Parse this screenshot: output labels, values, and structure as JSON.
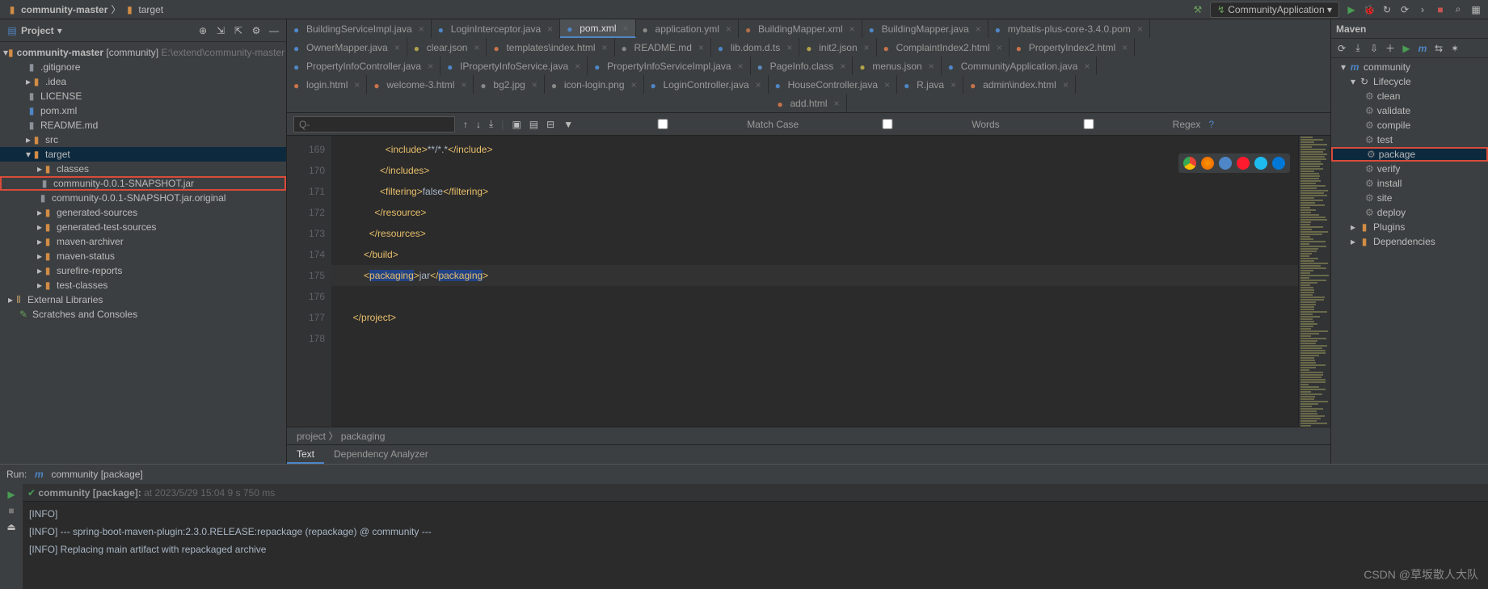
{
  "breadcrumbs": [
    "community-master",
    "target"
  ],
  "runConfig": "CommunityApplication",
  "project": {
    "title": "Project",
    "root": {
      "name": "community-master",
      "module": "[community]",
      "path": "E:\\extend\\community-master"
    },
    "items": [
      {
        "name": ".gitignore",
        "indent": 2,
        "icon": "file"
      },
      {
        "name": ".idea",
        "indent": 2,
        "icon": "folder",
        "arrow": true
      },
      {
        "name": "LICENSE",
        "indent": 2,
        "icon": "file"
      },
      {
        "name": "pom.xml",
        "indent": 2,
        "icon": "maven"
      },
      {
        "name": "README.md",
        "indent": 2,
        "icon": "file"
      },
      {
        "name": "src",
        "indent": 2,
        "icon": "folder",
        "arrow": true
      },
      {
        "name": "target",
        "indent": 2,
        "icon": "folder-orange",
        "arrow": true,
        "sel": true,
        "open": true
      },
      {
        "name": "classes",
        "indent": 3,
        "icon": "folder-orange",
        "arrow": true
      },
      {
        "name": "community-0.0.1-SNAPSHOT.jar",
        "indent": 3,
        "icon": "jar",
        "hl": true
      },
      {
        "name": "community-0.0.1-SNAPSHOT.jar.original",
        "indent": 3,
        "icon": "jar"
      },
      {
        "name": "generated-sources",
        "indent": 3,
        "icon": "folder-orange",
        "arrow": true
      },
      {
        "name": "generated-test-sources",
        "indent": 3,
        "icon": "folder-orange",
        "arrow": true
      },
      {
        "name": "maven-archiver",
        "indent": 3,
        "icon": "folder-orange",
        "arrow": true
      },
      {
        "name": "maven-status",
        "indent": 3,
        "icon": "folder-orange",
        "arrow": true
      },
      {
        "name": "surefire-reports",
        "indent": 3,
        "icon": "folder-orange",
        "arrow": true
      },
      {
        "name": "test-classes",
        "indent": 3,
        "icon": "folder-orange",
        "arrow": true
      }
    ],
    "extras": [
      "External Libraries",
      "Scratches and Consoles"
    ]
  },
  "tabRows": [
    [
      {
        "label": "BuildingServiceImpl.java",
        "icon": "java"
      },
      {
        "label": "LoginInterceptor.java",
        "icon": "java"
      },
      {
        "label": "pom.xml",
        "icon": "maven",
        "active": true
      },
      {
        "label": "application.yml",
        "icon": "yml"
      },
      {
        "label": "BuildingMapper.xml",
        "icon": "xml"
      },
      {
        "label": "BuildingMapper.java",
        "icon": "java"
      },
      {
        "label": "mybatis-plus-core-3.4.0.pom",
        "icon": "maven"
      }
    ],
    [
      {
        "label": "OwnerMapper.java",
        "icon": "java"
      },
      {
        "label": "clear.json",
        "icon": "json"
      },
      {
        "label": "templates\\index.html",
        "icon": "html"
      },
      {
        "label": "README.md",
        "icon": "md"
      },
      {
        "label": "lib.dom.d.ts",
        "icon": "ts"
      },
      {
        "label": "init2.json",
        "icon": "json"
      },
      {
        "label": "ComplaintIndex2.html",
        "icon": "html"
      },
      {
        "label": "PropertyIndex2.html",
        "icon": "html"
      }
    ],
    [
      {
        "label": "PropertyInfoController.java",
        "icon": "java"
      },
      {
        "label": "IPropertyInfoService.java",
        "icon": "java"
      },
      {
        "label": "PropertyInfoServiceImpl.java",
        "icon": "java"
      },
      {
        "label": "PageInfo.class",
        "icon": "class"
      },
      {
        "label": "menus.json",
        "icon": "json"
      },
      {
        "label": "CommunityApplication.java",
        "icon": "java"
      }
    ],
    [
      {
        "label": "login.html",
        "icon": "html"
      },
      {
        "label": "welcome-3.html",
        "icon": "html"
      },
      {
        "label": "bg2.jpg",
        "icon": "img"
      },
      {
        "label": "icon-login.png",
        "icon": "img"
      },
      {
        "label": "LoginController.java",
        "icon": "java"
      },
      {
        "label": "HouseController.java",
        "icon": "java"
      },
      {
        "label": "R.java",
        "icon": "java"
      },
      {
        "label": "admin\\index.html",
        "icon": "html"
      }
    ],
    [
      {
        "label": "add.html",
        "icon": "html",
        "center": true
      }
    ]
  ],
  "search": {
    "placeholder": "Q-",
    "matchCase": "Match Case",
    "words": "Words",
    "regex": "Regex"
  },
  "code": {
    "lines": [
      {
        "n": 169,
        "pad": 20,
        "html": "<span class='tag'>&lt;include&gt;</span><span class='txt'>**/*.*</span><span class='tag'>&lt;/include&gt;</span>"
      },
      {
        "n": 170,
        "pad": 18,
        "html": "<span class='tag'>&lt;/includes&gt;</span>"
      },
      {
        "n": 171,
        "pad": 18,
        "html": "<span class='tag'>&lt;filtering&gt;</span><span class='txt'>false</span><span class='tag'>&lt;/filtering&gt;</span>"
      },
      {
        "n": 172,
        "pad": 16,
        "html": "<span class='tag'>&lt;/resource&gt;</span>"
      },
      {
        "n": 173,
        "pad": 14,
        "html": "<span class='tag'>&lt;/resources&gt;</span>"
      },
      {
        "n": 174,
        "pad": 12,
        "html": "<span class='tag'>&lt;/build&gt;</span>"
      },
      {
        "n": 175,
        "pad": 12,
        "html": "<span class='tag'>&lt;<span class='hl-pkg'>packaging</span>&gt;</span><span class='txt'>jar</span><span class='tag'>&lt;/<span class='hl-pkg'>packaging</span>&gt;</span>",
        "cursor": true
      },
      {
        "n": 176,
        "pad": 0,
        "html": ""
      },
      {
        "n": 177,
        "pad": 8,
        "html": "<span class='tag'>&lt;/project&gt;</span>"
      },
      {
        "n": 178,
        "pad": 0,
        "html": ""
      }
    ],
    "crumbs": [
      "project",
      "packaging"
    ],
    "edTabs": [
      "Text",
      "Dependency Analyzer"
    ]
  },
  "maven": {
    "title": "Maven",
    "root": "community",
    "lifecycle": "Lifecycle",
    "phases": [
      "clean",
      "validate",
      "compile",
      "test",
      "package",
      "verify",
      "install",
      "site",
      "deploy"
    ],
    "selected": "package",
    "plugins": "Plugins",
    "deps": "Dependencies"
  },
  "run": {
    "label": "Run:",
    "config": "community [package]",
    "status": "community [package]:",
    "time": "at 2023/5/29 15:04 9 s 750 ms",
    "lines": [
      "[INFO]",
      "[INFO] --- spring-boot-maven-plugin:2.3.0.RELEASE:repackage (repackage) @ community ---",
      "[INFO] Replacing main artifact with repackaged archive"
    ]
  },
  "watermark": "CSDN @草坂散人大队"
}
